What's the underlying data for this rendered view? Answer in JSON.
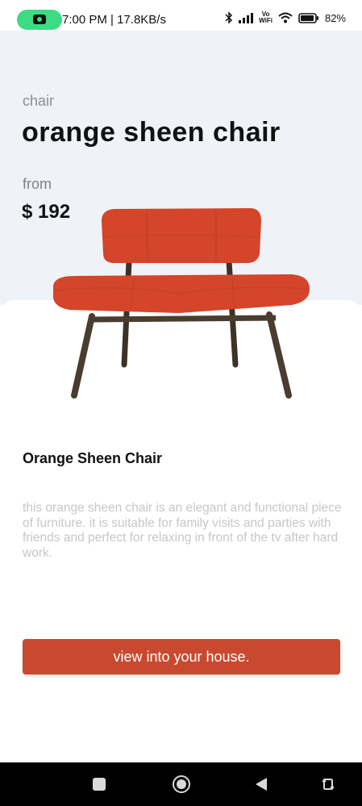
{
  "status_bar": {
    "time": "7:00 PM | 17.8KB/s",
    "vowifi_top": "Vo",
    "vowifi_bottom": "WiFi",
    "battery": "82%"
  },
  "product": {
    "category": "chair",
    "title": "orange sheen chair",
    "from_label": "from",
    "price": "$ 192",
    "name": "Orange Sheen Chair",
    "description": "this orange sheen chair is an elegant and functional piece of furniture. it is suitable for family visits and parties with friends and perfect for relaxing in front of the tv after hard work."
  },
  "cta": {
    "label": "view into your house."
  },
  "colors": {
    "accent": "#c8492f",
    "hero_bg": "#eff2f7",
    "chair_fabric": "#d4452a",
    "chair_legs": "#4a3c2e"
  },
  "nav_icons": [
    "recents-icon",
    "home-icon",
    "back-icon",
    "rotate-icon"
  ]
}
